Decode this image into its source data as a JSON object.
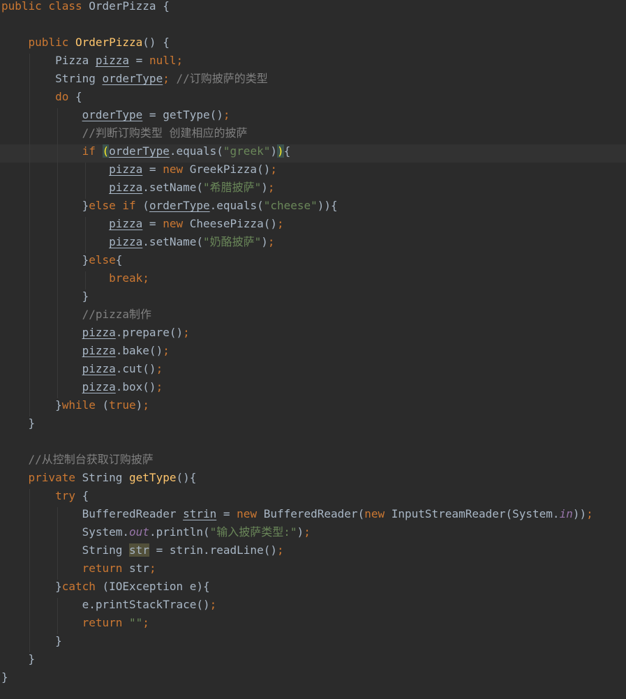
{
  "editor": {
    "language": "Java",
    "lines": [
      [
        {
          "t": "public class ",
          "c": "kw"
        },
        {
          "t": "OrderPizza {",
          "c": ""
        }
      ],
      [],
      [
        {
          "t": "    public ",
          "c": "kw"
        },
        {
          "t": "OrderPizza",
          "c": "fn"
        },
        {
          "t": "() {",
          "c": ""
        }
      ],
      [
        {
          "t": "        Pizza ",
          "c": ""
        },
        {
          "t": "pizza",
          "c": "ul"
        },
        {
          "t": " = ",
          "c": ""
        },
        {
          "t": "null",
          "c": "nul"
        },
        {
          "t": ";",
          "c": "kw"
        }
      ],
      [
        {
          "t": "        String ",
          "c": ""
        },
        {
          "t": "orderType",
          "c": "ul"
        },
        {
          "t": "; ",
          "c": "kw"
        },
        {
          "t": "//订购披萨的类型",
          "c": "cmt"
        }
      ],
      [
        {
          "t": "        do ",
          "c": "kw"
        },
        {
          "t": "{",
          "c": ""
        }
      ],
      [
        {
          "t": "            ",
          "c": ""
        },
        {
          "t": "orderType",
          "c": "ul"
        },
        {
          "t": " = getType()",
          "c": ""
        },
        {
          "t": ";",
          "c": "kw"
        }
      ],
      [
        {
          "t": "            //判断订购类型 创建相应的披萨",
          "c": "cmt"
        }
      ],
      [
        {
          "t": "            if ",
          "c": "kw"
        },
        {
          "t": "(",
          "c": "brmatch"
        },
        {
          "t": "orderType",
          "c": "ul"
        },
        {
          "t": ".equals(",
          "c": ""
        },
        {
          "t": "\"greek\"",
          "c": "str"
        },
        {
          "t": ")",
          "c": ""
        },
        {
          "t": ")",
          "c": "brmatch"
        },
        {
          "t": "{",
          "c": ""
        }
      ],
      [
        {
          "t": "                ",
          "c": ""
        },
        {
          "t": "pizza",
          "c": "ul"
        },
        {
          "t": " = ",
          "c": ""
        },
        {
          "t": "new ",
          "c": "kw"
        },
        {
          "t": "GreekPizza()",
          "c": ""
        },
        {
          "t": ";",
          "c": "kw"
        }
      ],
      [
        {
          "t": "                ",
          "c": ""
        },
        {
          "t": "pizza",
          "c": "ul"
        },
        {
          "t": ".setName(",
          "c": ""
        },
        {
          "t": "\"希腊披萨\"",
          "c": "str"
        },
        {
          "t": ")",
          "c": ""
        },
        {
          "t": ";",
          "c": "kw"
        }
      ],
      [
        {
          "t": "            }",
          "c": ""
        },
        {
          "t": "else if ",
          "c": "kw"
        },
        {
          "t": "(",
          "c": ""
        },
        {
          "t": "orderType",
          "c": "ul"
        },
        {
          "t": ".equals(",
          "c": ""
        },
        {
          "t": "\"cheese\"",
          "c": "str"
        },
        {
          "t": ")){",
          "c": ""
        }
      ],
      [
        {
          "t": "                ",
          "c": ""
        },
        {
          "t": "pizza",
          "c": "ul"
        },
        {
          "t": " = ",
          "c": ""
        },
        {
          "t": "new ",
          "c": "kw"
        },
        {
          "t": "CheesePizza()",
          "c": ""
        },
        {
          "t": ";",
          "c": "kw"
        }
      ],
      [
        {
          "t": "                ",
          "c": ""
        },
        {
          "t": "pizza",
          "c": "ul"
        },
        {
          "t": ".setName(",
          "c": ""
        },
        {
          "t": "\"奶酪披萨\"",
          "c": "str"
        },
        {
          "t": ")",
          "c": ""
        },
        {
          "t": ";",
          "c": "kw"
        }
      ],
      [
        {
          "t": "            }",
          "c": ""
        },
        {
          "t": "else",
          "c": "kw"
        },
        {
          "t": "{",
          "c": ""
        }
      ],
      [
        {
          "t": "                break;",
          "c": "kw"
        }
      ],
      [
        {
          "t": "            }",
          "c": ""
        }
      ],
      [
        {
          "t": "            //pizza制作",
          "c": "cmt"
        }
      ],
      [
        {
          "t": "            ",
          "c": ""
        },
        {
          "t": "pizza",
          "c": "ul"
        },
        {
          "t": ".prepare()",
          "c": ""
        },
        {
          "t": ";",
          "c": "kw"
        }
      ],
      [
        {
          "t": "            ",
          "c": ""
        },
        {
          "t": "pizza",
          "c": "ul"
        },
        {
          "t": ".bake()",
          "c": ""
        },
        {
          "t": ";",
          "c": "kw"
        }
      ],
      [
        {
          "t": "            ",
          "c": ""
        },
        {
          "t": "pizza",
          "c": "ul"
        },
        {
          "t": ".cut()",
          "c": ""
        },
        {
          "t": ";",
          "c": "kw"
        }
      ],
      [
        {
          "t": "            ",
          "c": ""
        },
        {
          "t": "pizza",
          "c": "ul"
        },
        {
          "t": ".box()",
          "c": ""
        },
        {
          "t": ";",
          "c": "kw"
        }
      ],
      [
        {
          "t": "        }",
          "c": ""
        },
        {
          "t": "while ",
          "c": "kw"
        },
        {
          "t": "(",
          "c": ""
        },
        {
          "t": "true",
          "c": "kw"
        },
        {
          "t": ")",
          "c": ""
        },
        {
          "t": ";",
          "c": "kw"
        }
      ],
      [
        {
          "t": "    }",
          "c": ""
        }
      ],
      [],
      [
        {
          "t": "    //从控制台获取订购披萨",
          "c": "cmt"
        }
      ],
      [
        {
          "t": "    private ",
          "c": "kw"
        },
        {
          "t": "String ",
          "c": ""
        },
        {
          "t": "getType",
          "c": "fn"
        },
        {
          "t": "(){",
          "c": ""
        }
      ],
      [
        {
          "t": "        try ",
          "c": "kw"
        },
        {
          "t": "{",
          "c": ""
        }
      ],
      [
        {
          "t": "            BufferedReader ",
          "c": ""
        },
        {
          "t": "strin",
          "c": "ul"
        },
        {
          "t": " = ",
          "c": ""
        },
        {
          "t": "new ",
          "c": "kw"
        },
        {
          "t": "BufferedReader(",
          "c": ""
        },
        {
          "t": "new ",
          "c": "kw"
        },
        {
          "t": "InputStreamReader(System.",
          "c": ""
        },
        {
          "t": "in",
          "c": "fld"
        },
        {
          "t": "))",
          "c": ""
        },
        {
          "t": ";",
          "c": "kw"
        }
      ],
      [
        {
          "t": "            System.",
          "c": ""
        },
        {
          "t": "out",
          "c": "fld"
        },
        {
          "t": ".println(",
          "c": ""
        },
        {
          "t": "\"输入披萨类型:\"",
          "c": "str"
        },
        {
          "t": ")",
          "c": ""
        },
        {
          "t": ";",
          "c": "kw"
        }
      ],
      [
        {
          "t": "            String ",
          "c": ""
        },
        {
          "t": "str",
          "c": "hl"
        },
        {
          "t": " = strin.readLine()",
          "c": ""
        },
        {
          "t": ";",
          "c": "kw"
        }
      ],
      [
        {
          "t": "            return ",
          "c": "kw"
        },
        {
          "t": "str",
          "c": ""
        },
        {
          "t": ";",
          "c": "kw"
        }
      ],
      [
        {
          "t": "        }",
          "c": ""
        },
        {
          "t": "catch ",
          "c": "kw"
        },
        {
          "t": "(IOException e){",
          "c": ""
        }
      ],
      [
        {
          "t": "            e.printStackTrace()",
          "c": ""
        },
        {
          "t": ";",
          "c": "kw"
        }
      ],
      [
        {
          "t": "            return ",
          "c": "kw"
        },
        {
          "t": "\"\"",
          "c": "str"
        },
        {
          "t": ";",
          "c": "kw"
        }
      ],
      [
        {
          "t": "        }",
          "c": ""
        }
      ],
      [
        {
          "t": "    }",
          "c": ""
        }
      ],
      [
        {
          "t": "}",
          "c": ""
        }
      ]
    ],
    "current_line_index": 8
  }
}
